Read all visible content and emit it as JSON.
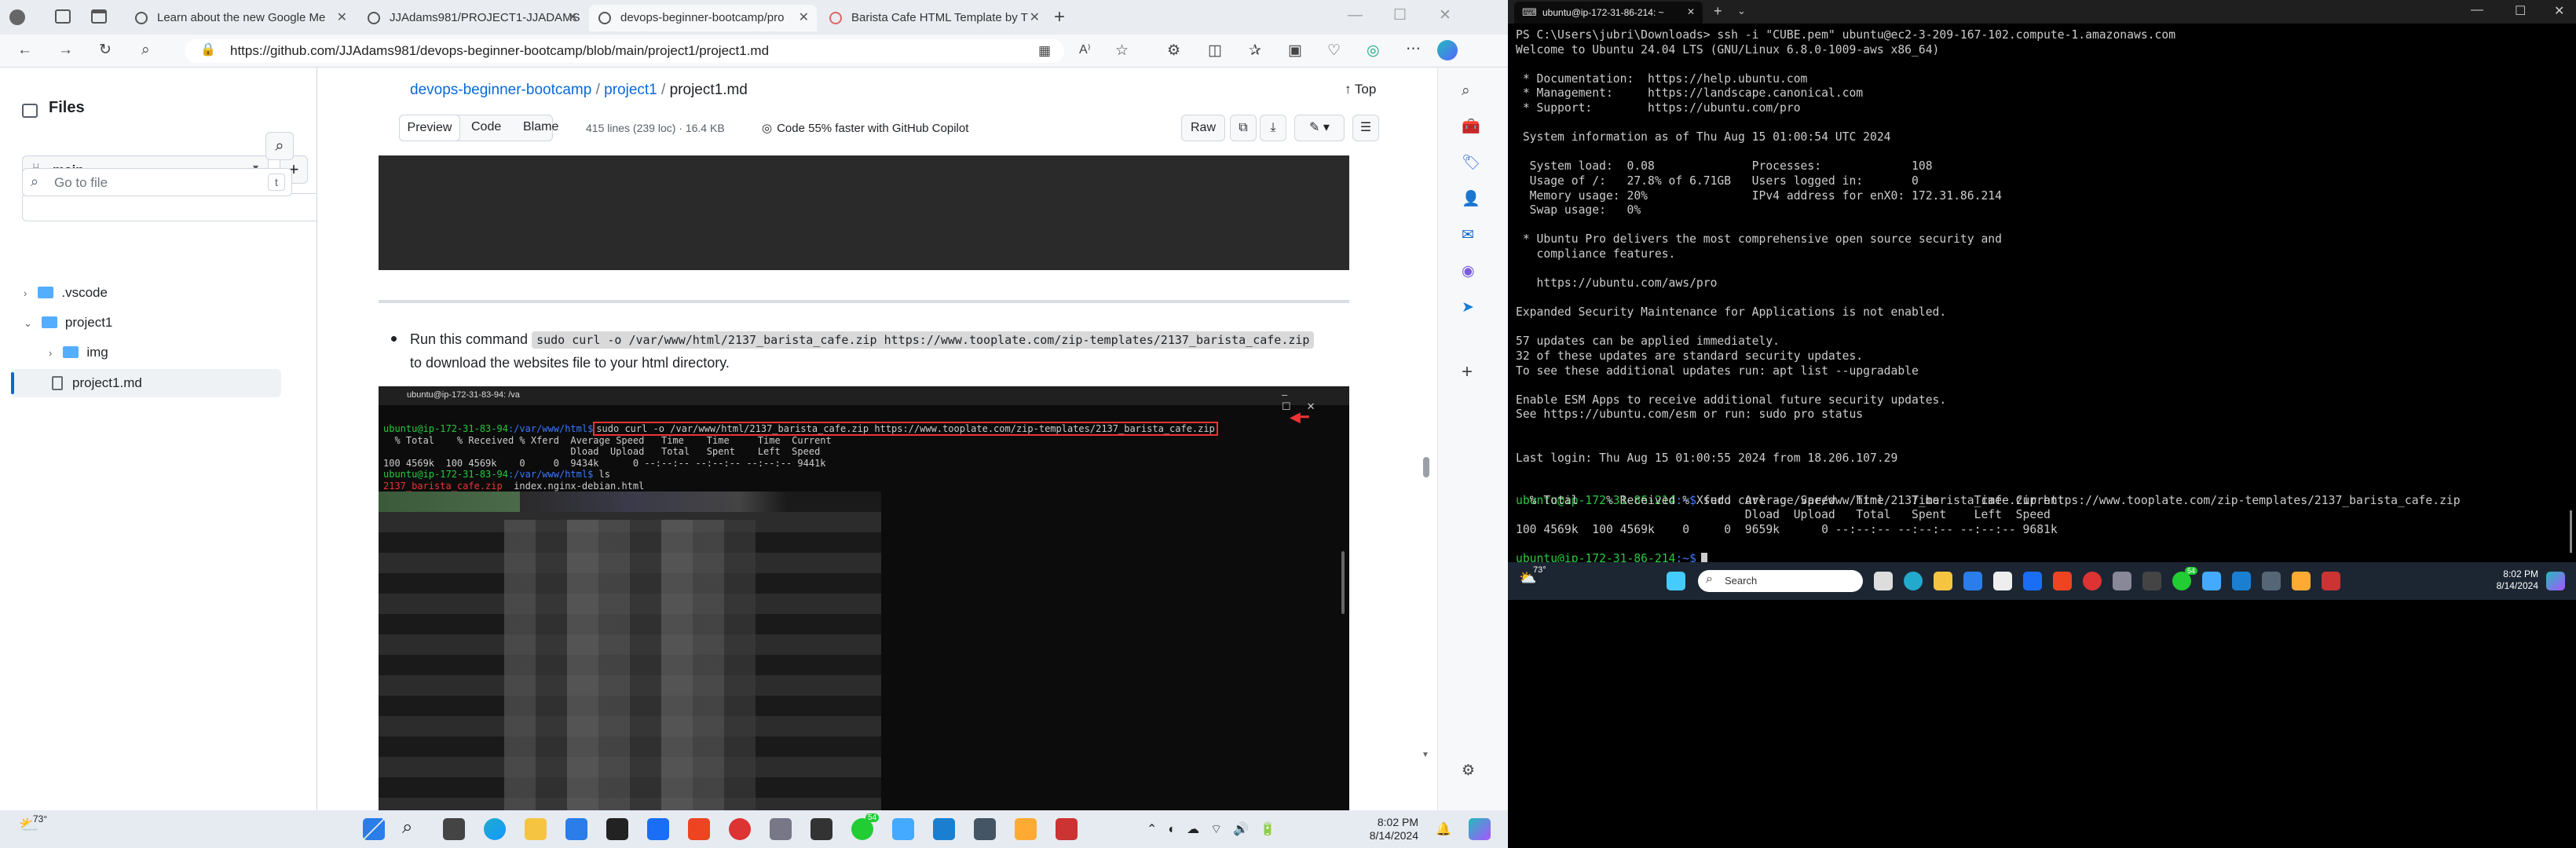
{
  "browser": {
    "tabs": [
      {
        "label": "Learn about the new Google Me"
      },
      {
        "label": "JJAdams981/PROJECT1-JJADAMS"
      },
      {
        "label": "devops-beginner-bootcamp/pro"
      },
      {
        "label": "Barista Cafe HTML Template by T"
      }
    ],
    "url": "https://github.com/JJAdams981/devops-beginner-bootcamp/blob/main/project1/project1.md"
  },
  "github": {
    "sidebar_title": "Files",
    "branch": "main",
    "goto_placeholder": "Go to file",
    "goto_shortcut": "t",
    "tree": [
      {
        "label": ".vscode"
      },
      {
        "label": "project1"
      },
      {
        "label": "img"
      },
      {
        "label": "project1.md"
      }
    ],
    "breadcrumb": {
      "repo": "devops-beginner-bootcamp",
      "sep1": "/",
      "folder": "project1",
      "sep2": "/",
      "file": "project1.md"
    },
    "top_label": "Top",
    "view_tabs": [
      "Preview",
      "Code",
      "Blame"
    ],
    "file_meta": "415 lines (239 loc) · 16.4 KB",
    "copilot": "Code 55% faster with GitHub Copilot",
    "raw_label": "Raw",
    "bullet_prefix": "Run this command",
    "bullet_code": "sudo curl -o /var/www/html/2137_barista_cafe.zip https://www.tooplate.com/zip-templates/2137_barista_cafe.zip",
    "bullet_suffix": "to download the websites file to your html directory.",
    "shot": {
      "title": "ubuntu@ip-172-31-83-94: /va",
      "prompt_user": "ubuntu@ip-172-31-83-94",
      "prompt_path": ":/var/www/html$",
      "cmd": "sudo curl -o /var/www/html/2137_barista_cafe.zip https://www.tooplate.com/zip-templates/2137_barista_cafe.zip",
      "hdr1": "  % Total    % Received % Xferd  Average Speed   Time    Time     Time  Current",
      "hdr2": "                                 Dload  Upload   Total   Spent    Left  Speed",
      "progress": "100 4569k  100 4569k    0     0  9434k      0 --:--:-- --:--:-- --:--:-- 9441k",
      "ls": " ls",
      "file1": "2137_barista_cafe.zip",
      "file2": "index.nginx-debian.html"
    }
  },
  "terminal": {
    "tab_title": "ubuntu@ip-172-31-86-214: ~",
    "lines": [
      "PS C:\\Users\\jubri\\Downloads> ssh -i \"CUBE.pem\" ubuntu@ec2-3-209-167-102.compute-1.amazonaws.com",
      "Welcome to Ubuntu 24.04 LTS (GNU/Linux 6.8.0-1009-aws x86_64)",
      "",
      " * Documentation:  https://help.ubuntu.com",
      " * Management:     https://landscape.canonical.com",
      " * Support:        https://ubuntu.com/pro",
      "",
      " System information as of Thu Aug 15 01:00:54 UTC 2024",
      "",
      "  System load:  0.08              Processes:             108",
      "  Usage of /:   27.8% of 6.71GB   Users logged in:       0",
      "  Memory usage: 20%               IPv4 address for enX0: 172.31.86.214",
      "  Swap usage:   0%",
      "",
      " * Ubuntu Pro delivers the most comprehensive open source security and",
      "   compliance features.",
      "",
      "   https://ubuntu.com/aws/pro",
      "",
      "Expanded Security Maintenance for Applications is not enabled.",
      "",
      "57 updates can be applied immediately.",
      "32 of these updates are standard security updates.",
      "To see these additional updates run: apt list --upgradable",
      "",
      "Enable ESM Apps to receive additional future security updates.",
      "See https://ubuntu.com/esm or run: sudo pro status",
      "",
      "",
      "Last login: Thu Aug 15 01:00:55 2024 from 18.206.107.29"
    ],
    "prompt_user": "ubuntu@ip-172-31-86-214",
    "prompt_path": ":~$",
    "cmd": " sudo curl -o /var/www/html/2137_barista_cafe.zip https://www.tooplate.com/zip-templates/2137_barista_cafe.zip",
    "out1": "  % Total    % Received % Xferd  Average Speed   Time    Time     Time  Current",
    "out2": "                                 Dload  Upload   Total   Spent    Left  Speed",
    "out3": "100 4569k  100 4569k    0     0  9659k      0 --:--:-- --:--:-- --:--:-- 9681k"
  },
  "taskbar_left": {
    "weather": "73°",
    "time": "8:02 PM",
    "date": "8/14/2024",
    "badge": "54"
  },
  "taskbar_right": {
    "weather": "73°",
    "search": "Search",
    "time": "8:02 PM",
    "date": "8/14/2024",
    "badge": "54"
  }
}
